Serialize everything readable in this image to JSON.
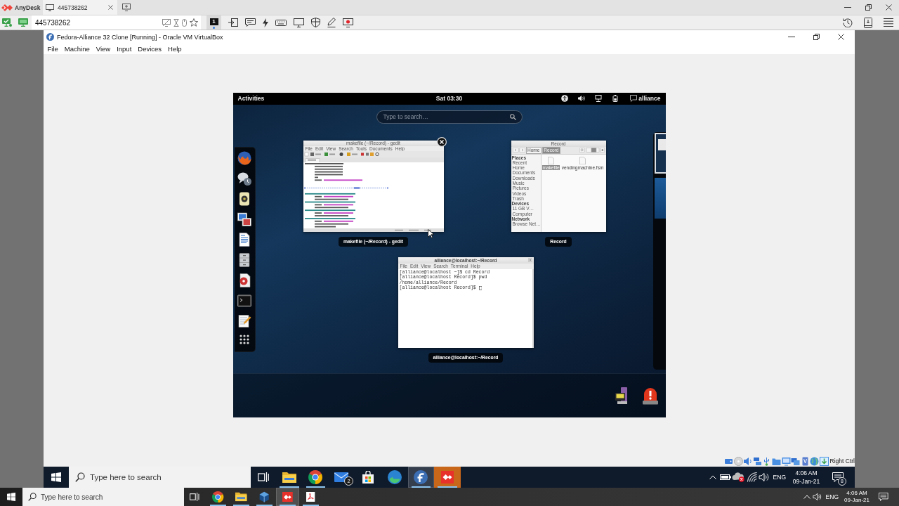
{
  "anydesk": {
    "app_name": "AnyDesk",
    "tabs": [
      {
        "label": "445738262",
        "selected": true
      }
    ],
    "address": {
      "value": "445738262"
    },
    "display_button": {
      "label": "1",
      "selected": true
    }
  },
  "virtualbox": {
    "title": "Fedora-Alliance 32 Clone [Running] - Oracle VM VirtualBox",
    "menu": [
      "File",
      "Machine",
      "View",
      "Input",
      "Devices",
      "Help"
    ],
    "host_key": "Right Ctrl"
  },
  "gnome": {
    "activities": "Activities",
    "clock": "Sat 03:30",
    "user": "alliance",
    "search": {
      "placeholder": "Type to search…"
    },
    "windows": [
      {
        "kind": "editor",
        "title": "makefile (~/Record) - gedit",
        "menu": [
          "File",
          "Edit",
          "View",
          "Search",
          "Tools",
          "Documents",
          "Help"
        ],
        "caption": "makefile (~/Record) - gedit",
        "close_button": true
      },
      {
        "kind": "files",
        "title": "Record",
        "path": [
          {
            "label": "Home",
            "selected": false
          },
          {
            "label": "Record",
            "selected": true
          }
        ],
        "sidebar": [
          {
            "heading": "Places",
            "items": [
              "Recent",
              "Home",
              "Documents",
              "Downloads",
              "Music",
              "Pictures",
              "Videos",
              "Trash"
            ]
          },
          {
            "heading": "Devices",
            "items": [
              "11 GB V…",
              "Computer"
            ]
          },
          {
            "heading": "Network",
            "items": [
              "Browse Net…"
            ]
          }
        ],
        "files": [
          {
            "name": "makefile",
            "selected": true
          },
          {
            "name": "vendingmachine.fsm",
            "selected": false
          }
        ],
        "caption": "Record",
        "close_button": false
      },
      {
        "kind": "terminal",
        "title": "alliance@localhost:~/Record",
        "menu": [
          "File",
          "Edit",
          "View",
          "Search",
          "Terminal",
          "Help"
        ],
        "lines": [
          "[alliance@localhost ~]$ cd Record",
          "[alliance@localhost Record]$ pwd",
          "/home/alliance/Record",
          "[alliance@localhost Record]$"
        ],
        "caption": "alliance@localhost:~/Record",
        "close_button": false
      }
    ],
    "workspaces": [
      {
        "selected": true
      },
      {
        "selected": false
      }
    ]
  },
  "remote_taskbar": {
    "search": {
      "placeholder": "Type here to search"
    },
    "apps": [
      {
        "kind": "folder",
        "running": true,
        "selected": false,
        "attention": false
      },
      {
        "kind": "ring",
        "running": true,
        "selected": false,
        "attention": false
      },
      {
        "kind": "envelope",
        "running": false,
        "selected": false,
        "attention": false,
        "badge": "2"
      },
      {
        "kind": "bag",
        "running": false,
        "selected": false,
        "attention": false
      },
      {
        "kind": "swirl",
        "running": false,
        "selected": false,
        "attention": false
      },
      {
        "kind": "f-logo",
        "running": true,
        "selected": true,
        "attention": false
      },
      {
        "kind": "diamonds",
        "running": true,
        "selected": false,
        "attention": true
      }
    ],
    "language": "ENG",
    "time": "4:06 AM",
    "date": "09-Jan-21",
    "notifications": "8"
  },
  "local_taskbar": {
    "search": {
      "placeholder": "Type here to search"
    },
    "apps": [
      {
        "kind": "ring",
        "running": true,
        "selected": false,
        "attention": false
      },
      {
        "kind": "folder",
        "running": true,
        "selected": false,
        "attention": false
      },
      {
        "kind": "cube",
        "running": true,
        "selected": false,
        "attention": false
      },
      {
        "kind": "diamonds",
        "running": true,
        "selected": true,
        "attention": false
      },
      {
        "kind": "pdf",
        "running": true,
        "selected": false,
        "attention": false
      }
    ],
    "language": "ENG",
    "time": "4:06 AM",
    "date": "09-Jan-21"
  }
}
